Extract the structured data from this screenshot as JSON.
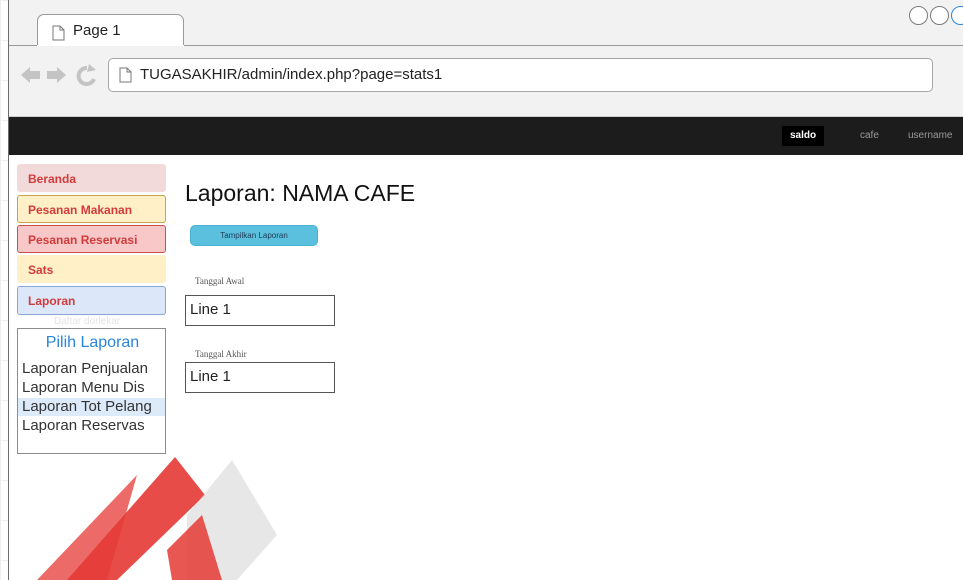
{
  "browser": {
    "tab_title": "Page 1",
    "url": "TUGASAKHIR/admin/index.php?page=stats1"
  },
  "navbar": {
    "items": [
      {
        "label": "saldo",
        "active": true
      },
      {
        "label": "cafe",
        "active": false
      },
      {
        "label": "username",
        "active": false
      }
    ]
  },
  "sidebar": {
    "menu": [
      {
        "label": "Beranda"
      },
      {
        "label": "Pesanan Makanan"
      },
      {
        "label": "Pesanan Reservasi"
      },
      {
        "label": "Sats"
      },
      {
        "label": "Laporan"
      }
    ],
    "ghost_text": "Daftar dorlekar",
    "report_list": {
      "title": "Pilih Laporan",
      "options": [
        "Laporan Penjualan",
        "Laporan Menu Dis",
        "Laporan Tot Pelang",
        "Laporan Reservas"
      ],
      "selected_index": 2
    }
  },
  "main": {
    "title": "Laporan: NAMA CAFE",
    "show_button": "Tampilkan Laporan",
    "start_label": "Tanggal Awal",
    "start_value": "Line 1",
    "end_label": "Tanggal  Akhir",
    "end_value": "Line 1"
  },
  "colors": {
    "accent_blue": "#2a86d9",
    "button_cyan": "#5bc0de",
    "menu_red_text": "#d23b3b",
    "navbar_bg": "#1c1c1c",
    "watermark_red": "#e53935"
  }
}
